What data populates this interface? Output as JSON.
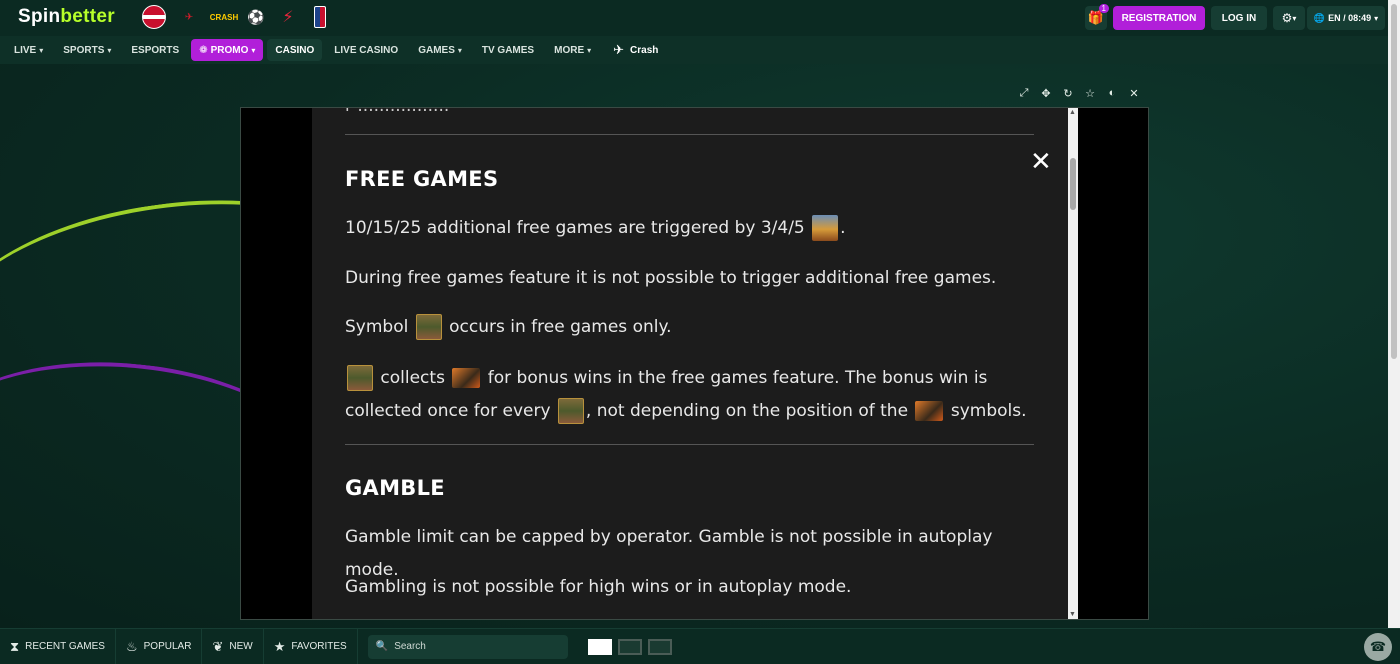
{
  "brand": {
    "logo_a": "Spin",
    "logo_b": "better"
  },
  "partners": [
    "flag-latvia",
    "crash-logo",
    "champions-league-logo",
    "laliga-logo",
    "nba-logo"
  ],
  "partner_texts": {
    "crash": "CRASH"
  },
  "header": {
    "gift_badge": "1",
    "registration": "REGISTRATION",
    "login": "LOG IN",
    "lang_time": "EN / 08:49"
  },
  "nav": {
    "live": "LIVE",
    "sports": "SPORTS",
    "esports": "ESPORTS",
    "promo": "PROMO",
    "casino": "CASINO",
    "live_casino": "LIVE CASINO",
    "games": "GAMES",
    "tv_games": "TV GAMES",
    "more": "MORE",
    "crash": "Crash"
  },
  "game_tools": [
    "fullscreen-icon",
    "move-icon",
    "reload-icon",
    "star-icon",
    "toggle-icon",
    "close-icon"
  ],
  "paytable": {
    "free_games_title": "FREE GAMES",
    "fg_line1_a": "10/15/25 additional free games are triggered by 3/4/5",
    "fg_line1_b": ".",
    "fg_line2": "During free games feature it is not possible to trigger additional free games.",
    "fg_line3_a": "Symbol",
    "fg_line3_b": "occurs in free games only.",
    "fg_line4_a": "collects",
    "fg_line4_b": "for bonus wins in the free games feature. The bonus win is collected once for every",
    "fg_line4_c": ", not depending on the position of the",
    "fg_line4_d": "symbols.",
    "gamble_title": "GAMBLE",
    "gamble_line1": "Gamble limit can be capped by operator. Gamble is not possible in autoplay mode.",
    "gamble_line2": "Gambling is not possible for high wins or in autoplay mode."
  },
  "bottom": {
    "recent": "RECENT GAMES",
    "popular": "POPULAR",
    "new": "NEW",
    "favorites": "FAVORITES",
    "search_placeholder": "Search"
  },
  "colors": {
    "accent": "#b11fd9",
    "background": "#0b2a22",
    "logo_green": "#b7ff2a"
  }
}
